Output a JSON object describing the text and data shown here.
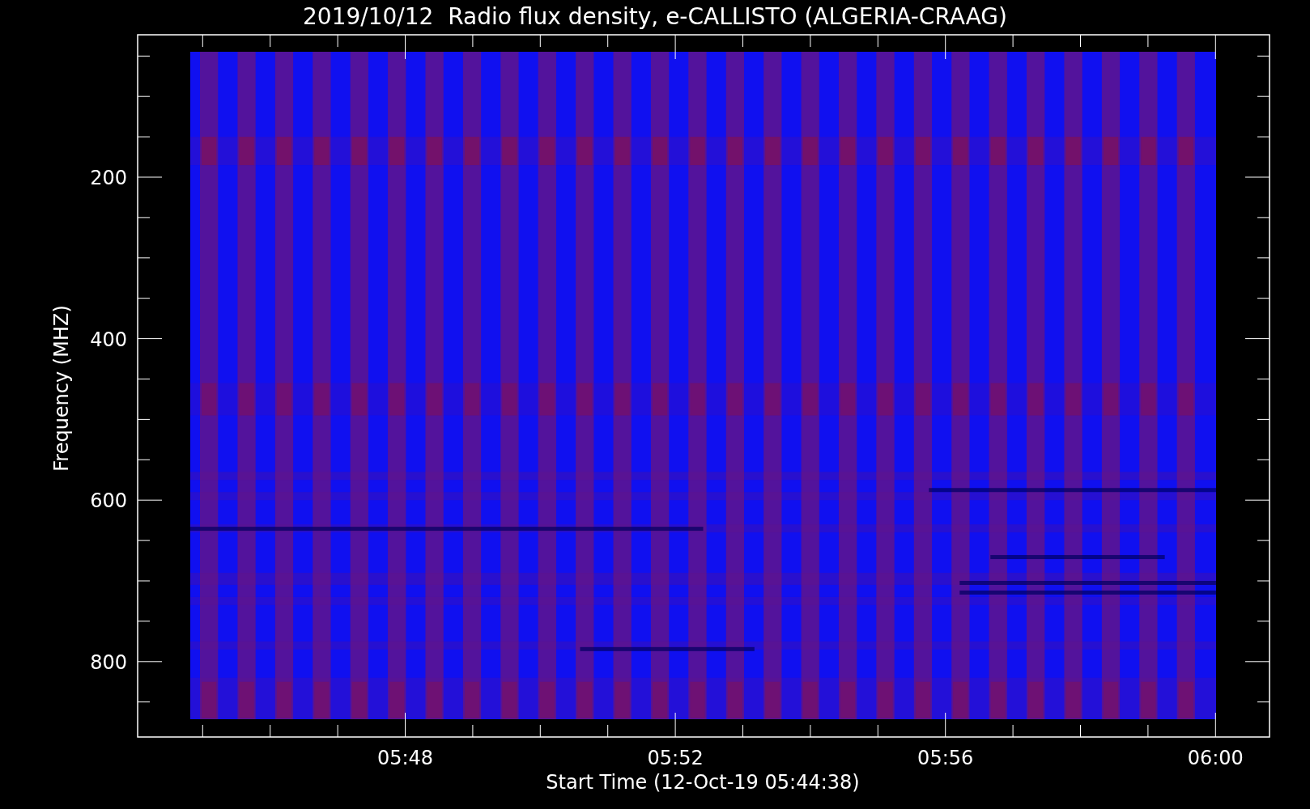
{
  "plot": {
    "title": "2019/10/12  Radio flux density, e-CALLISTO (ALGERIA-CRAAG)",
    "y_axis": {
      "label": "Frequency (MHZ)",
      "ticks": [
        "200",
        "400",
        "600",
        "800"
      ]
    },
    "x_axis": {
      "label": "Start Time (12-Oct-19 05:44:38)",
      "ticks": [
        "05:48",
        "05:52",
        "05:56",
        "06:00"
      ]
    }
  }
}
